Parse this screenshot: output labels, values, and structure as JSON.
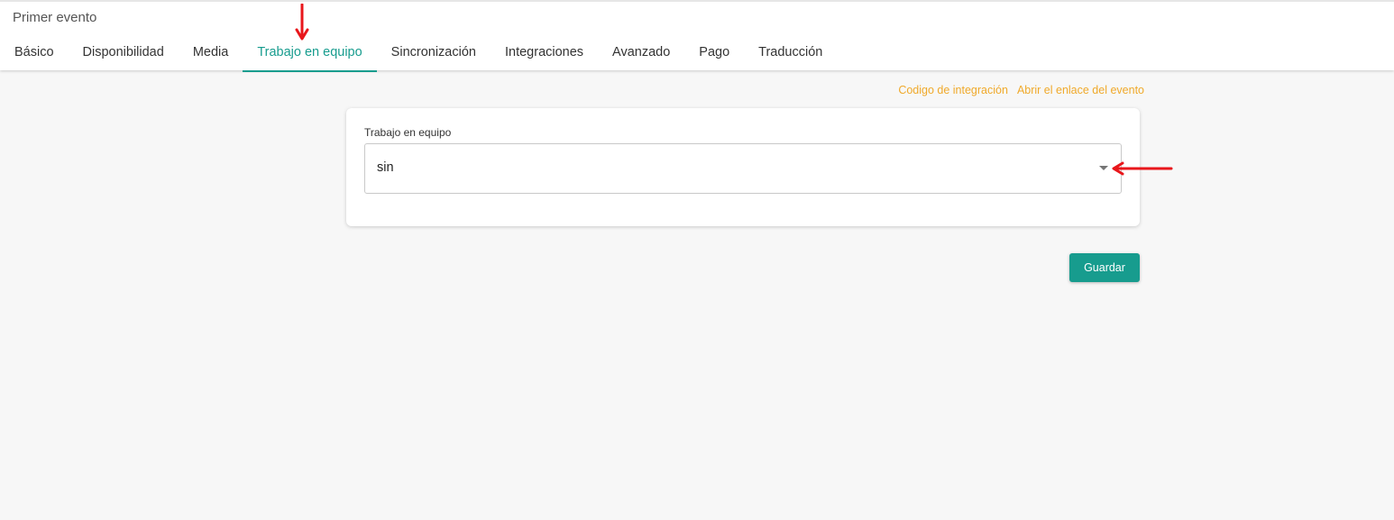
{
  "header": {
    "title": "Primer evento"
  },
  "tabs": [
    {
      "label": "Básico",
      "active": false
    },
    {
      "label": "Disponibilidad",
      "active": false
    },
    {
      "label": "Media",
      "active": false
    },
    {
      "label": "Trabajo en equipo",
      "active": true
    },
    {
      "label": "Sincronización",
      "active": false
    },
    {
      "label": "Integraciones",
      "active": false
    },
    {
      "label": "Avanzado",
      "active": false
    },
    {
      "label": "Pago",
      "active": false
    },
    {
      "label": "Traducción",
      "active": false
    }
  ],
  "links": {
    "integration_code": "Codigo de integración",
    "open_event_link": "Abrir el enlace del evento"
  },
  "form": {
    "teamwork_label": "Trabajo en equipo",
    "teamwork_value": "sin"
  },
  "actions": {
    "save_label": "Guardar"
  },
  "colors": {
    "accent": "#179c8e",
    "link": "#f0a92a",
    "annotation": "#e8161b"
  },
  "icons": {
    "select_caret": "caret-down-icon",
    "annotation": "red-arrow-icon"
  }
}
